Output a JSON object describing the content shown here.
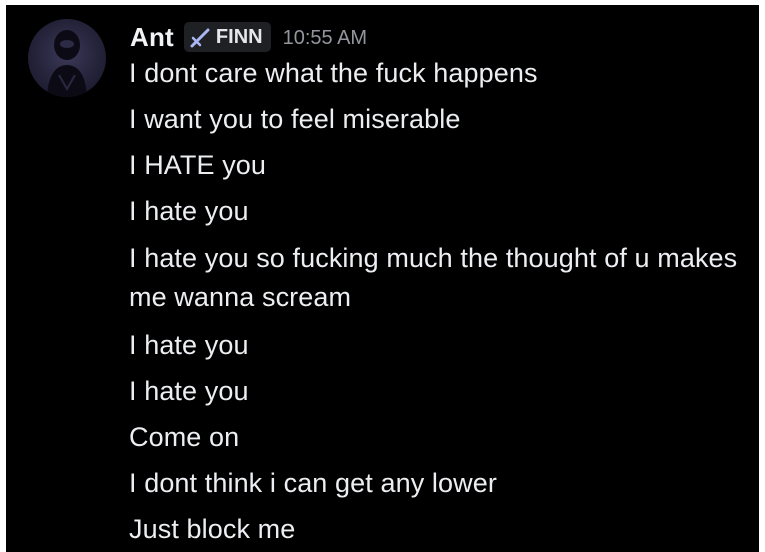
{
  "message": {
    "author": "Ant",
    "tag": {
      "icon": "sword-icon",
      "text": "FINN"
    },
    "timestamp": "10:55 AM",
    "avatar_icon": "avatar-icon",
    "lines": [
      "I dont care what the fuck happens",
      "I want you to feel miserable",
      "I HATE you",
      "I hate you",
      "I hate you so fucking much the thought of u makes me wanna scream",
      "I hate you",
      "I hate you",
      "Come on",
      "I dont think i can get any lower",
      "Just block me"
    ]
  },
  "colors": {
    "background": "#000000",
    "text": "#eceef1",
    "timestamp": "#93969d",
    "tag_background": "#1f2023"
  }
}
